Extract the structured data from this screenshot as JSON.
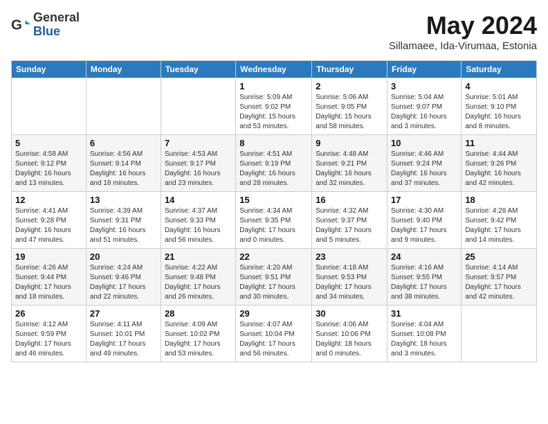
{
  "logo": {
    "general": "General",
    "blue": "Blue"
  },
  "title": "May 2024",
  "subtitle": "Sillamaee, Ida-Virumaa, Estonia",
  "headers": [
    "Sunday",
    "Monday",
    "Tuesday",
    "Wednesday",
    "Thursday",
    "Friday",
    "Saturday"
  ],
  "weeks": [
    [
      {
        "day": "",
        "info": ""
      },
      {
        "day": "",
        "info": ""
      },
      {
        "day": "",
        "info": ""
      },
      {
        "day": "1",
        "info": "Sunrise: 5:09 AM\nSunset: 9:02 PM\nDaylight: 15 hours\nand 53 minutes."
      },
      {
        "day": "2",
        "info": "Sunrise: 5:06 AM\nSunset: 9:05 PM\nDaylight: 15 hours\nand 58 minutes."
      },
      {
        "day": "3",
        "info": "Sunrise: 5:04 AM\nSunset: 9:07 PM\nDaylight: 16 hours\nand 3 minutes."
      },
      {
        "day": "4",
        "info": "Sunrise: 5:01 AM\nSunset: 9:10 PM\nDaylight: 16 hours\nand 8 minutes."
      }
    ],
    [
      {
        "day": "5",
        "info": "Sunrise: 4:58 AM\nSunset: 9:12 PM\nDaylight: 16 hours\nand 13 minutes."
      },
      {
        "day": "6",
        "info": "Sunrise: 4:56 AM\nSunset: 9:14 PM\nDaylight: 16 hours\nand 18 minutes."
      },
      {
        "day": "7",
        "info": "Sunrise: 4:53 AM\nSunset: 9:17 PM\nDaylight: 16 hours\nand 23 minutes."
      },
      {
        "day": "8",
        "info": "Sunrise: 4:51 AM\nSunset: 9:19 PM\nDaylight: 16 hours\nand 28 minutes."
      },
      {
        "day": "9",
        "info": "Sunrise: 4:48 AM\nSunset: 9:21 PM\nDaylight: 16 hours\nand 32 minutes."
      },
      {
        "day": "10",
        "info": "Sunrise: 4:46 AM\nSunset: 9:24 PM\nDaylight: 16 hours\nand 37 minutes."
      },
      {
        "day": "11",
        "info": "Sunrise: 4:44 AM\nSunset: 9:26 PM\nDaylight: 16 hours\nand 42 minutes."
      }
    ],
    [
      {
        "day": "12",
        "info": "Sunrise: 4:41 AM\nSunset: 9:28 PM\nDaylight: 16 hours\nand 47 minutes."
      },
      {
        "day": "13",
        "info": "Sunrise: 4:39 AM\nSunset: 9:31 PM\nDaylight: 16 hours\nand 51 minutes."
      },
      {
        "day": "14",
        "info": "Sunrise: 4:37 AM\nSunset: 9:33 PM\nDaylight: 16 hours\nand 56 minutes."
      },
      {
        "day": "15",
        "info": "Sunrise: 4:34 AM\nSunset: 9:35 PM\nDaylight: 17 hours\nand 0 minutes."
      },
      {
        "day": "16",
        "info": "Sunrise: 4:32 AM\nSunset: 9:37 PM\nDaylight: 17 hours\nand 5 minutes."
      },
      {
        "day": "17",
        "info": "Sunrise: 4:30 AM\nSunset: 9:40 PM\nDaylight: 17 hours\nand 9 minutes."
      },
      {
        "day": "18",
        "info": "Sunrise: 4:28 AM\nSunset: 9:42 PM\nDaylight: 17 hours\nand 14 minutes."
      }
    ],
    [
      {
        "day": "19",
        "info": "Sunrise: 4:26 AM\nSunset: 9:44 PM\nDaylight: 17 hours\nand 18 minutes."
      },
      {
        "day": "20",
        "info": "Sunrise: 4:24 AM\nSunset: 9:46 PM\nDaylight: 17 hours\nand 22 minutes."
      },
      {
        "day": "21",
        "info": "Sunrise: 4:22 AM\nSunset: 9:48 PM\nDaylight: 17 hours\nand 26 minutes."
      },
      {
        "day": "22",
        "info": "Sunrise: 4:20 AM\nSunset: 9:51 PM\nDaylight: 17 hours\nand 30 minutes."
      },
      {
        "day": "23",
        "info": "Sunrise: 4:18 AM\nSunset: 9:53 PM\nDaylight: 17 hours\nand 34 minutes."
      },
      {
        "day": "24",
        "info": "Sunrise: 4:16 AM\nSunset: 9:55 PM\nDaylight: 17 hours\nand 38 minutes."
      },
      {
        "day": "25",
        "info": "Sunrise: 4:14 AM\nSunset: 9:57 PM\nDaylight: 17 hours\nand 42 minutes."
      }
    ],
    [
      {
        "day": "26",
        "info": "Sunrise: 4:12 AM\nSunset: 9:59 PM\nDaylight: 17 hours\nand 46 minutes."
      },
      {
        "day": "27",
        "info": "Sunrise: 4:11 AM\nSunset: 10:01 PM\nDaylight: 17 hours\nand 49 minutes."
      },
      {
        "day": "28",
        "info": "Sunrise: 4:09 AM\nSunset: 10:02 PM\nDaylight: 17 hours\nand 53 minutes."
      },
      {
        "day": "29",
        "info": "Sunrise: 4:07 AM\nSunset: 10:04 PM\nDaylight: 17 hours\nand 56 minutes."
      },
      {
        "day": "30",
        "info": "Sunrise: 4:06 AM\nSunset: 10:06 PM\nDaylight: 18 hours\nand 0 minutes."
      },
      {
        "day": "31",
        "info": "Sunrise: 4:04 AM\nSunset: 10:08 PM\nDaylight: 18 hours\nand 3 minutes."
      },
      {
        "day": "",
        "info": ""
      }
    ]
  ]
}
